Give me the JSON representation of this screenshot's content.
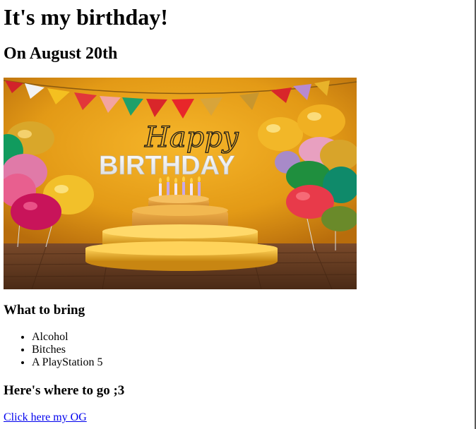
{
  "page": {
    "title": "It's my birthday!",
    "date_heading": "On August 20th",
    "image": {
      "name": "happy-birthday-banner",
      "script_word": "Happy",
      "banner_word": "BIRTHDAY"
    },
    "bring_heading": "What to bring",
    "bring_items": [
      "Alcohol",
      "Bitches",
      "A PlayStation 5"
    ],
    "where_heading": "Here's where to go ;3",
    "link_text": "Click here my OG"
  },
  "colors": {
    "link": "#0000ee",
    "text": "#000000",
    "background": "#ffffff",
    "banner_wall": "#e8a11c",
    "banner_floor": "#6b3f24"
  }
}
